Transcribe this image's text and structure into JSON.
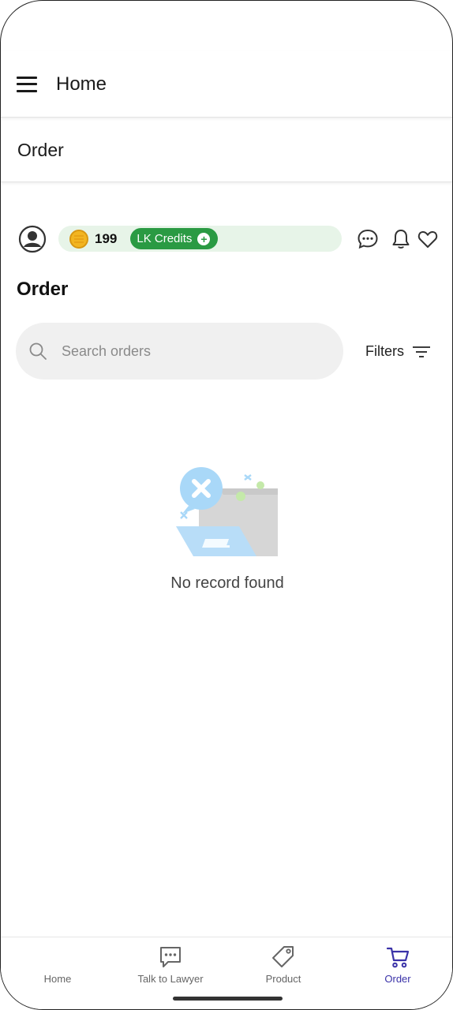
{
  "app_bar": {
    "title": "Home",
    "menu_icon": "hamburger-menu-icon"
  },
  "section_bar": {
    "title": "Order"
  },
  "top_row": {
    "avatar_icon": "user-circle-icon",
    "coin_icon": "coin-icon",
    "credits_count": "199",
    "credits_label": "LK Credits",
    "credits_add": "+",
    "chat_icon": "chat-bubble-icon",
    "bell_icon": "bell-icon",
    "heart_icon": "heart-icon"
  },
  "page_heading": "Order",
  "search": {
    "placeholder": "Search orders",
    "value": "",
    "icon": "search-icon"
  },
  "filters": {
    "label": "Filters",
    "icon": "filter-lines-icon"
  },
  "empty_state": {
    "message": "No record found",
    "illustration": "empty-folder-illustration"
  },
  "bottom_nav": {
    "items": [
      {
        "label": "Home",
        "icon": "home-icon",
        "active": false
      },
      {
        "label": "Talk to Lawyer",
        "icon": "chat-bubble-icon",
        "active": false
      },
      {
        "label": "Product",
        "icon": "price-tag-icon",
        "active": false
      },
      {
        "label": "Order",
        "icon": "cart-icon",
        "active": true
      }
    ]
  },
  "colors": {
    "accent_green": "#2a9a43",
    "pill_background": "#e7f4e8",
    "active_nav": "#3a32a8",
    "search_background": "#f0f0f0"
  }
}
